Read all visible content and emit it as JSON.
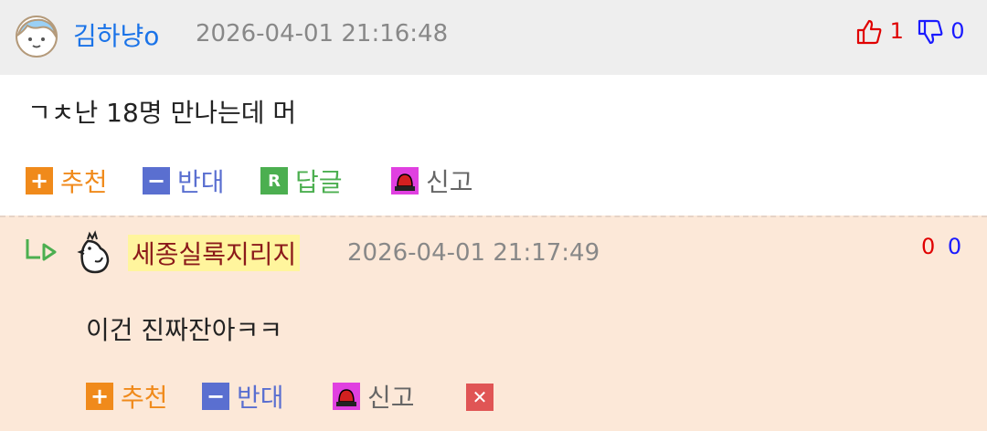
{
  "comment": {
    "nickname": "김하냥o",
    "datetime": "2026-04-01 21:16:48",
    "upvotes": "1",
    "downvotes": "0",
    "text": "ㄱㅊ난 18명 만나는데 머",
    "actions": {
      "recommend": "추천",
      "oppose": "반대",
      "reply": "답글",
      "report": "신고"
    }
  },
  "reply": {
    "nickname": "세종실록지리지",
    "datetime": "2026-04-01 21:17:49",
    "upvotes": "0",
    "downvotes": "0",
    "text": "이건 진짜잔아ㅋㅋ",
    "actions": {
      "recommend": "추천",
      "oppose": "반대",
      "report": "신고"
    }
  },
  "colors": {
    "up": "#e00000",
    "down": "#1a1aff",
    "recommend": "#f08a1b",
    "oppose": "#5a6fd0",
    "reply": "#4caf50",
    "report": "#666666",
    "delete": "#e05555"
  }
}
